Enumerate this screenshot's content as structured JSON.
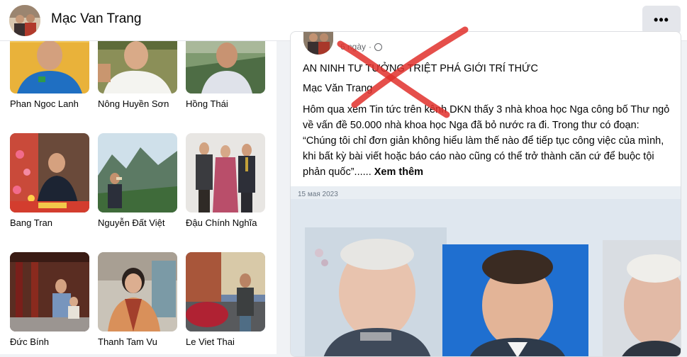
{
  "header": {
    "profile_name": "Mạc Van Trang",
    "more_button_label": "•••"
  },
  "friends": [
    {
      "name": "Phan Ngoc Lanh"
    },
    {
      "name": "Nông Huyền Sơn"
    },
    {
      "name": "Hồng Thái"
    },
    {
      "name": "Bang Tran"
    },
    {
      "name": "Nguyễn Đất Việt"
    },
    {
      "name": "Đậu Chính Nghĩa"
    },
    {
      "name": "Đức Bính"
    },
    {
      "name": "Thanh Tam Vu"
    },
    {
      "name": "Le Viet Thai"
    }
  ],
  "post": {
    "time": "6 ngày",
    "separator": "·",
    "title": "AN NINH TƯ TƯỞNG TRIỆT PHÁ GIỚI TRÍ THỨC",
    "author": "Mạc Văn Trang",
    "body": "Hôm qua xem Tin tức trên kênh DKN thấy 3 nhà khoa học Nga công bố Thư ngỏ về vấn đề 50.000 nhà khoa học Nga đã bỏ nước ra đi. Trong thư có đoạn: “Chúng tôi chỉ đơn giản không hiểu làm thế nào để tiếp tục công việc của mình, khi bất kỳ bài viết hoặc báo cáo nào cũng có thể trở thành căn cứ để buộc tội phản quốc”...... ",
    "see_more": "Xem thêm",
    "image_date": "15 мая 2023"
  },
  "colors": {
    "accent_red": "#e0302c",
    "text_secondary": "#65676b",
    "button_bg": "#e4e6eb"
  }
}
